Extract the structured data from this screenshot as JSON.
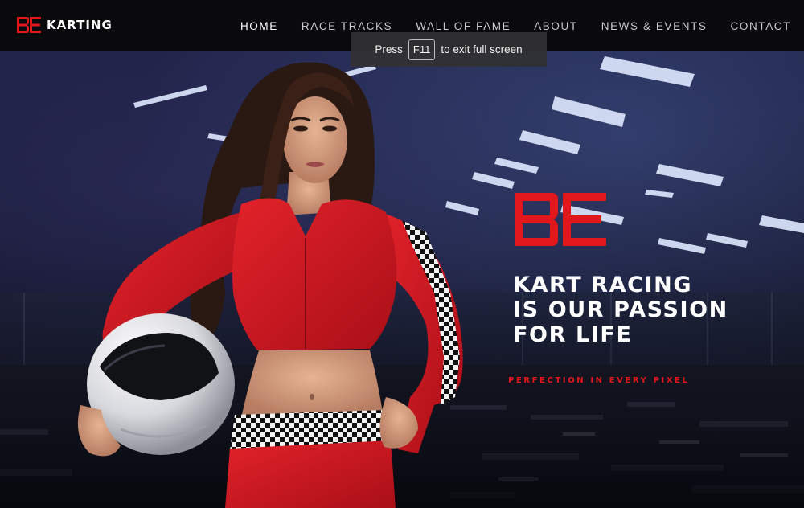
{
  "brand": {
    "mark": "BE",
    "name": "KARTING",
    "accent_color": "#e2171b"
  },
  "nav": {
    "items": [
      {
        "label": "HOME",
        "active": true
      },
      {
        "label": "RACE TRACKS",
        "active": false
      },
      {
        "label": "WALL OF FAME",
        "active": false
      },
      {
        "label": "ABOUT",
        "active": false
      },
      {
        "label": "NEWS & EVENTS",
        "active": false
      },
      {
        "label": "CONTACT",
        "active": false
      }
    ]
  },
  "fullscreen_notice": {
    "prefix": "Press",
    "key": "F11",
    "suffix": "to exit full screen"
  },
  "hero": {
    "logo_mark": "BE",
    "headline_lines": [
      "KART RACING",
      "IS OUR PASSION",
      "FOR LIFE"
    ],
    "tagline": "PERFECTION IN EVERY PIXEL",
    "image": "female kart racer in red suit holding white helmet, indoor karting track background"
  }
}
